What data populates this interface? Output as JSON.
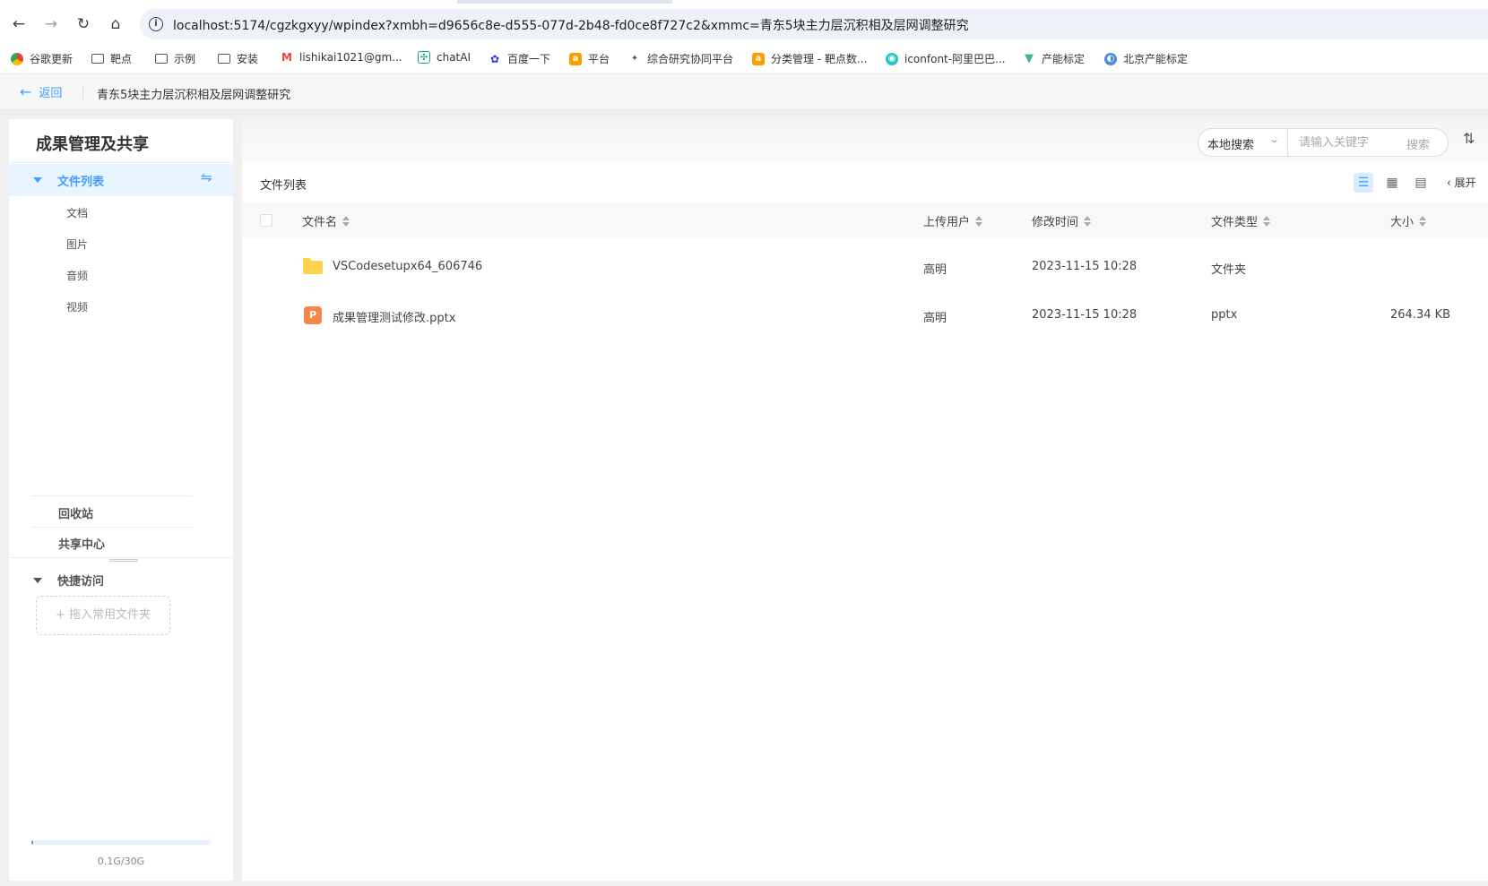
{
  "browser": {
    "url": "localhost:5174/cgzkgxyy/wpindex?xmbh=d9656c8e-d555-077d-2b48-fd0ce8f727c2&xmmc=青东5块主力层沉积相及层网调整研究",
    "bookmarks": [
      {
        "label": "谷歌更新",
        "icon": "chrome-icon"
      },
      {
        "label": "靶点",
        "icon": "folder-icon"
      },
      {
        "label": "示例",
        "icon": "folder-icon"
      },
      {
        "label": "安装",
        "icon": "folder-icon"
      },
      {
        "label": "lishikai1021@gm...",
        "icon": "gmail-icon"
      },
      {
        "label": "chatAI",
        "icon": "chatgpt-icon"
      },
      {
        "label": "百度一下",
        "icon": "baidu-icon"
      },
      {
        "label": "平台",
        "icon": "app-icon"
      },
      {
        "label": "综合研究协同平台",
        "icon": "puzzle-icon"
      },
      {
        "label": "分类管理 - 靶点数...",
        "icon": "app-icon"
      },
      {
        "label": "iconfont-阿里巴巴...",
        "icon": "iconfont-icon"
      },
      {
        "label": "产能标定",
        "icon": "vue-icon"
      },
      {
        "label": "北京产能标定",
        "icon": "globe-icon"
      }
    ]
  },
  "header": {
    "back_label": "返回",
    "project_title": "青东5块主力层沉积相及层网调整研究"
  },
  "sidebar": {
    "title": "成果管理及共享",
    "file_list_label": "文件列表",
    "sub_items": [
      "文档",
      "图片",
      "音频",
      "视频"
    ],
    "recycle_label": "回收站",
    "share_label": "共享中心",
    "quick_access_label": "快捷访问",
    "drop_zone_label": "+ 拖入常用文件夹",
    "storage_text": "0.1G/30G",
    "storage_used_fraction": 0.0033
  },
  "search": {
    "scope": "本地搜索",
    "placeholder": "请输入关键字",
    "button": "搜索"
  },
  "main": {
    "title": "文件列表",
    "expand_label": "展开",
    "columns": [
      "文件名",
      "上传用户",
      "修改时间",
      "文件类型",
      "大小"
    ],
    "rows": [
      {
        "icon": "folder-icon",
        "name": "VSCodesetupx64_606746",
        "user": "高明",
        "modified": "2023-11-15 10:28",
        "type": "文件夹",
        "size": ""
      },
      {
        "icon": "pptx-icon",
        "icon_letter": "P",
        "name": "成果管理测试修改.pptx",
        "user": "高明",
        "modified": "2023-11-15 10:28",
        "type": "pptx",
        "size": "264.34 KB"
      }
    ]
  },
  "colors": {
    "accent": "#409eff",
    "folder": "#ffd24d",
    "pptx": "#f4864a"
  }
}
